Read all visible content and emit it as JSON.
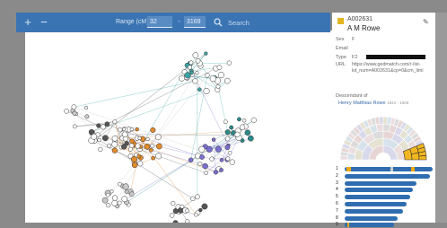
{
  "toolbar": {
    "zoom_in": "+",
    "zoom_out": "−",
    "range_label": "Range (cM)",
    "range_min": "32",
    "range_max": "3169",
    "range_sep": "-",
    "search_placeholder": "Search"
  },
  "profile": {
    "id": "A002631",
    "name": "A M Rowe",
    "fields": [
      {
        "label": "Sex",
        "value": "F"
      },
      {
        "label": "Email",
        "value": ""
      },
      {
        "label": "Type",
        "value": "F2"
      }
    ],
    "url_label": "URL",
    "url_value": "https://www.gedmatch.com/r-list-kit_num=A002631&cp=0&cm_limi",
    "descendant_label": "Descendant of",
    "descendant_name": "Henry Matthias Rowe",
    "descendant_years": "1843 - 1908",
    "colors": {
      "swatch": "#e0b520",
      "accent": "#2f6db0"
    }
  },
  "chromosomes": {
    "labels": [
      "1",
      "2",
      "3",
      "4",
      "5",
      "6",
      "7",
      "8",
      "9"
    ],
    "lengths": [
      1.0,
      0.97,
      0.82,
      0.78,
      0.74,
      0.7,
      0.66,
      0.6,
      0.56
    ],
    "highlight_segments": [
      {
        "chromosome": "1",
        "start": 0.02,
        "end": 0.07,
        "color": "#f2a900"
      },
      {
        "chromosome": "1",
        "start": 0.52,
        "end": 0.55,
        "color": "#cccccc"
      },
      {
        "chromosome": "1",
        "start": 0.75,
        "end": 0.8,
        "color": "#f2a900"
      },
      {
        "chromosome": "9",
        "start": 0.05,
        "end": 0.1,
        "color": "#f2a900"
      }
    ]
  },
  "graph": {
    "clusters": [
      {
        "color": "#3aa3a3"
      },
      {
        "color": "#e08a2a"
      },
      {
        "color": "#555555"
      },
      {
        "color": "#7a6fcf"
      },
      {
        "color": "#2d8a8a"
      },
      {
        "color": "#c9c9c9"
      }
    ]
  }
}
